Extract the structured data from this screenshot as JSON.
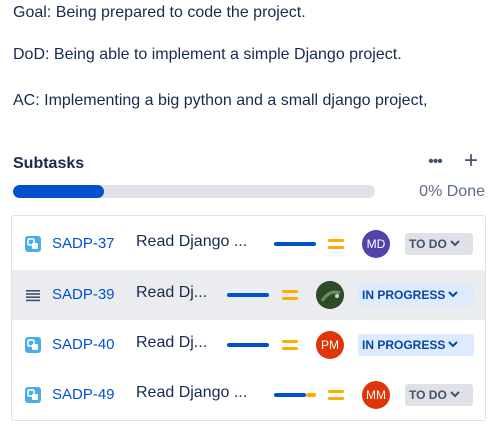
{
  "description": {
    "goal": "Goal: Being prepared to code the project.",
    "dod": "DoD: Being able to implement a simple Django project.",
    "ac": "AC: Implementing a big python and a small django project,"
  },
  "subtasks": {
    "title": "Subtasks",
    "more_label": "•••",
    "add_label": "+",
    "progress_label": "0% Done",
    "progress_fraction": 0.25,
    "colors": {
      "progress": "#0052cc",
      "todo_bg": "#dfe1e6",
      "in_progress_bg": "#deebff",
      "link": "#0052cc"
    },
    "items": [
      {
        "key": "SADP-37",
        "summary": "Read Django ...",
        "icon": "subtask-icon",
        "avatar_initials": "MD",
        "avatar_color": "#5243aa",
        "status": "TO DO",
        "status_type": "todo",
        "priority": "medium-priority-icon"
      },
      {
        "key": "SADP-39",
        "summary": "Read Dj...",
        "icon": "drag-handle-icon",
        "avatar_initials": "",
        "avatar_color": "#2f4a2a",
        "status": "IN PROGRESS",
        "status_type": "inprogress",
        "priority": "medium-priority-icon"
      },
      {
        "key": "SADP-40",
        "summary": "Read Dj...",
        "icon": "subtask-icon",
        "avatar_initials": "PM",
        "avatar_color": "#de350b",
        "status": "IN PROGRESS",
        "status_type": "inprogress",
        "priority": "medium-priority-icon"
      },
      {
        "key": "SADP-49",
        "summary": "Read Django ...",
        "icon": "subtask-icon",
        "avatar_initials": "MM",
        "avatar_color": "#de350b",
        "status": "TO DO",
        "status_type": "todo",
        "priority": "medium-priority-icon"
      }
    ]
  }
}
